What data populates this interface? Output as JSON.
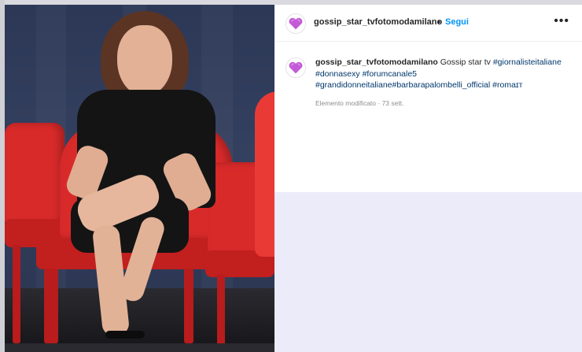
{
  "post": {
    "username": "gossip_star_tvfotomodamilano",
    "separator": "•",
    "follow_label": "Segui",
    "more_label": "•••",
    "caption": {
      "username": "gossip_star_tvfotomodamilano",
      "text": "Gossip star tv",
      "hashtags": [
        "#giornalisteitaliane",
        "#donnasexy",
        "#forumcanale5",
        "#grandidonneitaliane",
        "#barbarapalombelli_official",
        "#romaɪᴛ"
      ]
    },
    "edited_label": "Elemento modificato · 73 sett."
  },
  "icons": {
    "avatar": "pink-heart-avatar-icon",
    "more": "more-options-icon"
  },
  "colors": {
    "follow": "#0095f6",
    "hashtag": "#00376b",
    "chair": "#d92a2a",
    "dress": "#141414"
  }
}
